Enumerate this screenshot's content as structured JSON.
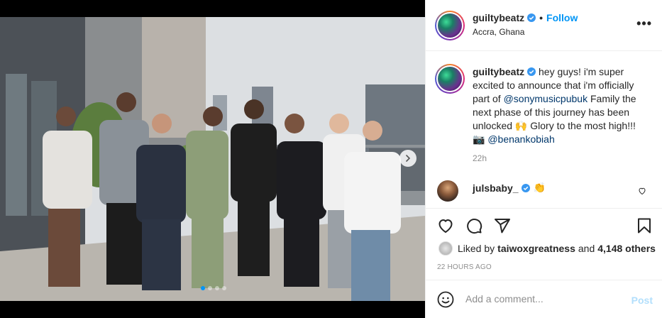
{
  "post": {
    "username": "guiltybeatz",
    "follow_label": "Follow",
    "location": "Accra, Ghana",
    "more_label": "•••",
    "caption": {
      "username": "guiltybeatz",
      "text_1": "hey guys! i'm super excited to announce that i'm officially part of ",
      "mention_1": "@sonymusicpubuk",
      "text_2": " Family the next phase of this journey has been unlocked 🙌 Glory to the most high!!! 📷 ",
      "mention_2": "@benankobiah",
      "time": "22h"
    },
    "comment": {
      "username": "julsbaby_",
      "emoji": "👏"
    },
    "likes": {
      "prefix": "Liked by",
      "user": "taiwoxgreatness",
      "joiner": "and",
      "others": "4,148 others"
    },
    "timestamp": "22 HOURS AGO",
    "add_comment": {
      "placeholder": "Add a comment...",
      "post_label": "Post"
    },
    "carousel": {
      "slides": 4,
      "active": 0
    }
  },
  "colors": {
    "link_blue": "#0095f6",
    "mention_blue": "#00376b",
    "verified_blue": "#3897f0",
    "muted": "#8e8e8e"
  },
  "icons": [
    "verified-badge-icon",
    "more-icon",
    "heart-icon",
    "comment-icon",
    "share-icon",
    "bookmark-icon",
    "emoji-icon",
    "chevron-right-icon"
  ]
}
